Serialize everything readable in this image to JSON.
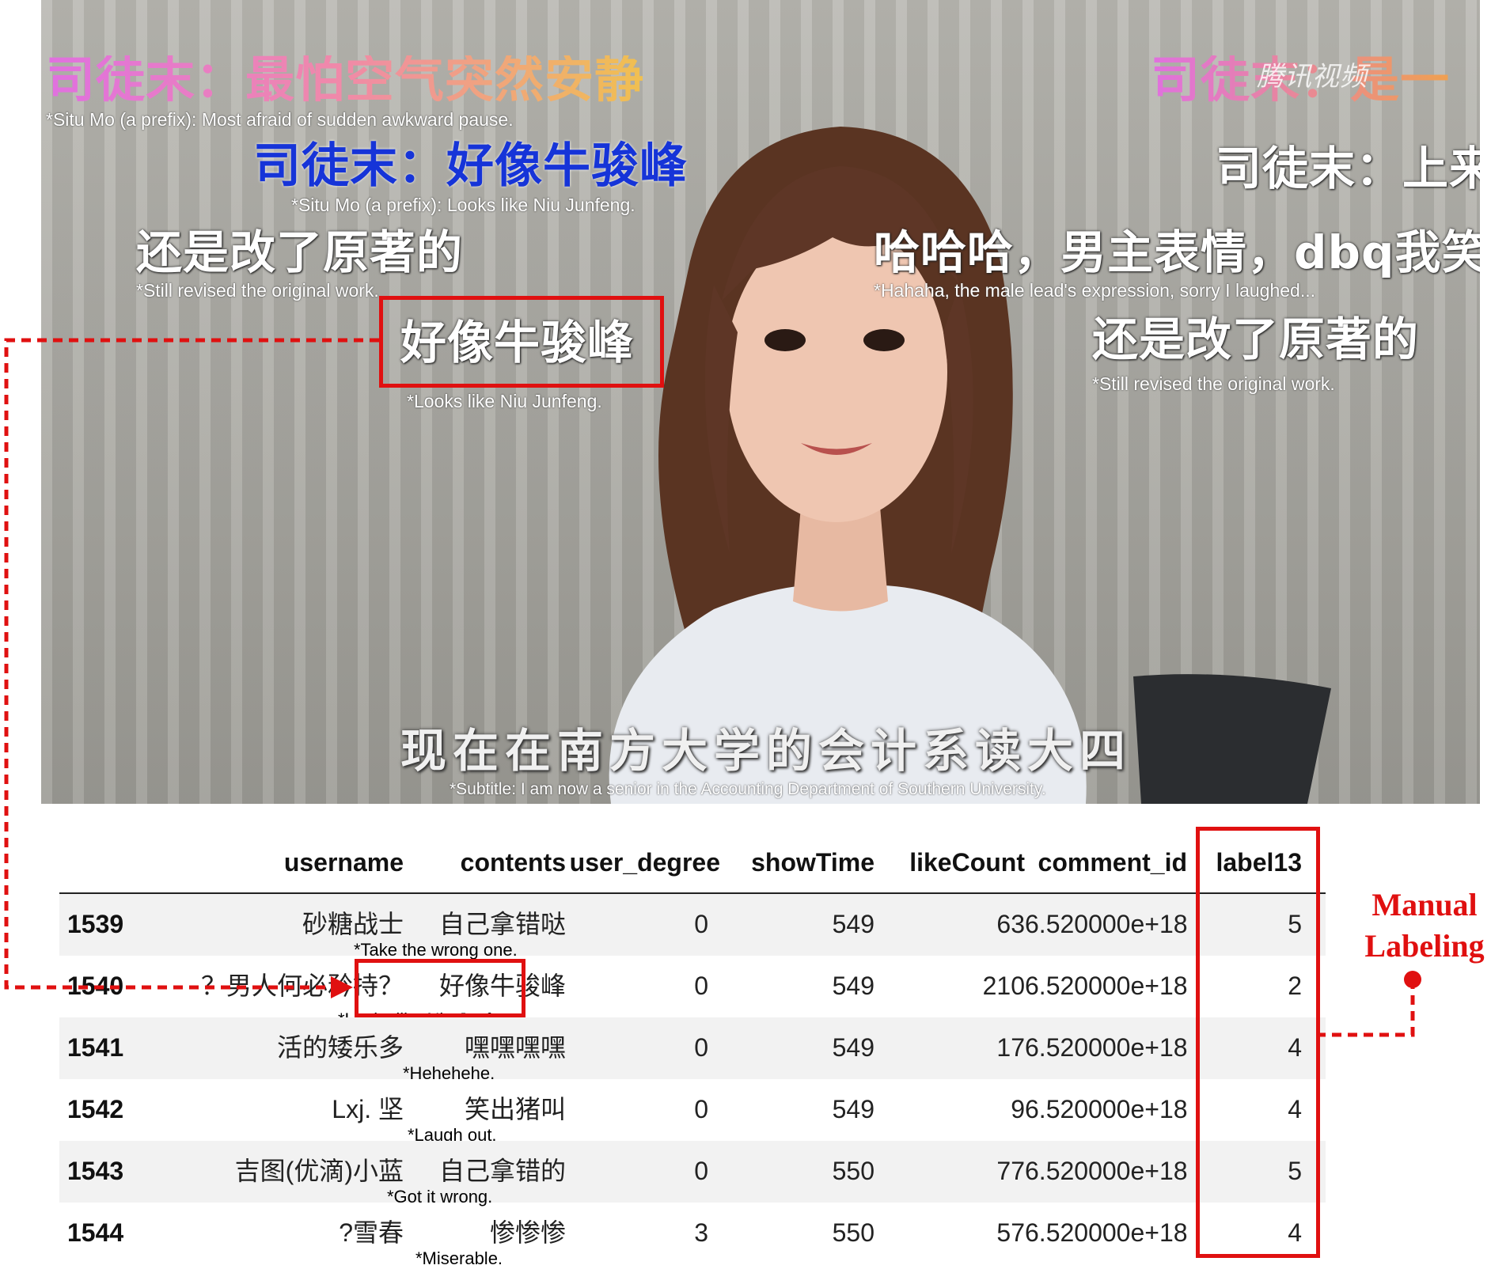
{
  "video": {
    "danmaku": [
      {
        "text": "司徒末：最怕空气突然安静",
        "note": "*Situ Mo (a prefix): Most afraid of sudden awkward pause."
      },
      {
        "text": "司徒末：好像牛骏峰",
        "note": "*Situ Mo (a prefix): Looks like Niu Junfeng."
      },
      {
        "text": "还是改了原著的",
        "note": "*Still revised the original work."
      },
      {
        "text": "好像牛骏峰",
        "note": "*Looks like Niu Junfeng."
      },
      {
        "text": "司徒末：是一",
        "note": ""
      },
      {
        "text": "司徒末：上来",
        "note": ""
      },
      {
        "text": "哈哈哈，男主表情，dbq我笑",
        "note": "*Hahaha, the male lead's expression, sorry I laughed..."
      },
      {
        "text": "还是改了原著的",
        "note": "*Still revised the original work."
      }
    ],
    "watermark": "腾讯视频",
    "subtitle": "现在在南方大学的会计系读大四",
    "subtitle_note": "*Subtitle: I am now a senior in the Accounting Department of Southern University."
  },
  "table": {
    "columns": [
      "username",
      "contents",
      "user_degree",
      "showTime",
      "likeCount",
      "comment_id",
      "label13"
    ],
    "rows": [
      {
        "index": "1539",
        "username": "砂糖战士",
        "contents": "自己拿错哒",
        "user_degree": "0",
        "showTime": "549",
        "likeCount": "63",
        "comment_id": "6.520000e+18",
        "label13": "5",
        "note": "*Take the wrong one."
      },
      {
        "index": "1540",
        "username": "？男人何必矜持？",
        "contents": "好像牛骏峰",
        "user_degree": "0",
        "showTime": "549",
        "likeCount": "210",
        "comment_id": "6.520000e+18",
        "label13": "2",
        "note": "*Looks like Niu Junfeng."
      },
      {
        "index": "1541",
        "username": "活的矮乐多",
        "contents": "嘿嘿嘿嘿",
        "user_degree": "0",
        "showTime": "549",
        "likeCount": "17",
        "comment_id": "6.520000e+18",
        "label13": "4",
        "note": "*Hehehehe."
      },
      {
        "index": "1542",
        "username": "Lxj. 坚",
        "contents": "笑出猪叫",
        "user_degree": "0",
        "showTime": "549",
        "likeCount": "9",
        "comment_id": "6.520000e+18",
        "label13": "4",
        "note": "*Laugh out."
      },
      {
        "index": "1543",
        "username": "吉图(优滴)小蓝",
        "contents": "自己拿错的",
        "user_degree": "0",
        "showTime": "550",
        "likeCount": "77",
        "comment_id": "6.520000e+18",
        "label13": "5",
        "note": "*Got it wrong."
      },
      {
        "index": "1544",
        "username": "?雪春",
        "contents": "惨惨惨",
        "user_degree": "3",
        "showTime": "550",
        "likeCount": "57",
        "comment_id": "6.520000e+18",
        "label13": "4",
        "note": "*Miserable."
      }
    ]
  },
  "annotation": {
    "manual_labeling_line1": "Manual",
    "manual_labeling_line2": "Labeling",
    "highlight_color": "#e01010"
  }
}
